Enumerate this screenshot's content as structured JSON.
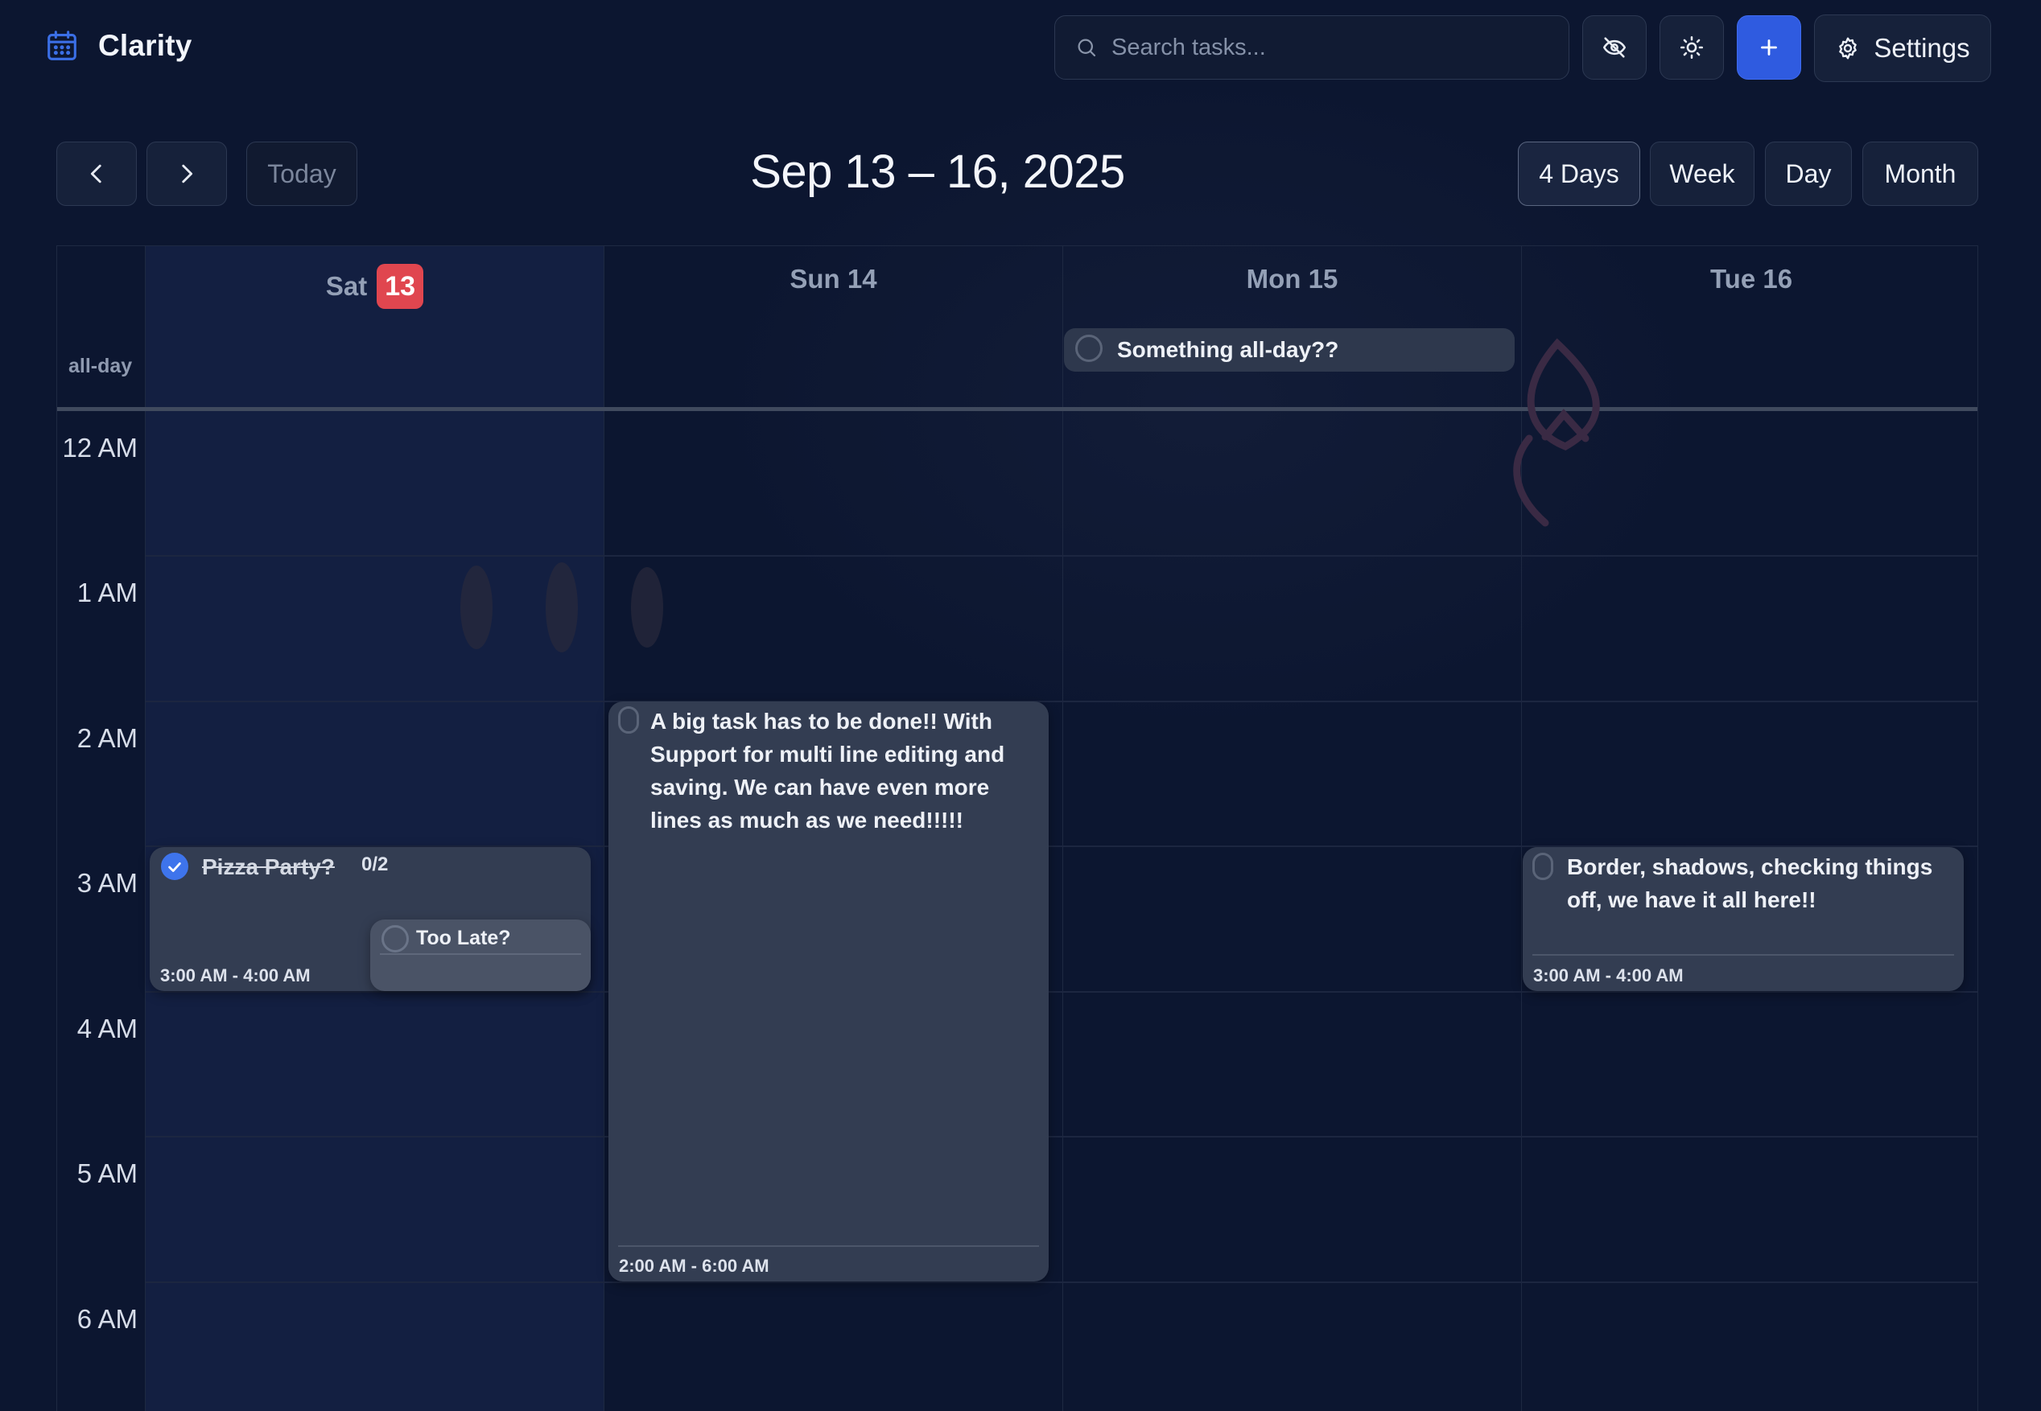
{
  "app": {
    "name": "Clarity"
  },
  "header": {
    "search_placeholder": "Search tasks...",
    "settings_label": "Settings"
  },
  "nav": {
    "today_label": "Today",
    "range_title": "Sep 13 – 16, 2025",
    "views": [
      "4 Days",
      "Week",
      "Day",
      "Month"
    ],
    "active_view": "4 Days"
  },
  "calendar": {
    "days": [
      {
        "weekday": "Sat",
        "date": "13",
        "is_today": true
      },
      {
        "weekday": "Sun",
        "date": "14",
        "is_today": false
      },
      {
        "weekday": "Mon",
        "date": "15",
        "is_today": false
      },
      {
        "weekday": "Tue",
        "date": "16",
        "is_today": false
      }
    ],
    "day_labels": [
      "Sun 14",
      "Mon 15",
      "Tue 16"
    ],
    "allday_label": "all-day",
    "hours": [
      "12 AM",
      "1 AM",
      "2 AM",
      "3 AM",
      "4 AM",
      "5 AM",
      "6 AM"
    ],
    "allday_events": [
      {
        "title": "Something all-day??",
        "completed": false
      }
    ],
    "events": [
      {
        "title": "Pizza Party?",
        "completed": true,
        "subtasks": "0/2",
        "time": "3:00 AM - 4:00 AM"
      },
      {
        "title": "Too Late?",
        "completed": false
      },
      {
        "title": "A big task has to be done!! With Support for multi line editing and saving. We can have even more lines as much as we need!!!!!",
        "completed": false,
        "time": "2:00 AM - 6:00 AM"
      },
      {
        "title": "Border, shadows, checking things off, we have it all here!!",
        "completed": false,
        "time": "3:00 AM - 4:00 AM"
      }
    ]
  },
  "colors": {
    "background": "#0c1630",
    "accent": "#2f5be0",
    "today_badge": "#e0464f",
    "event_card": "#333d52"
  }
}
